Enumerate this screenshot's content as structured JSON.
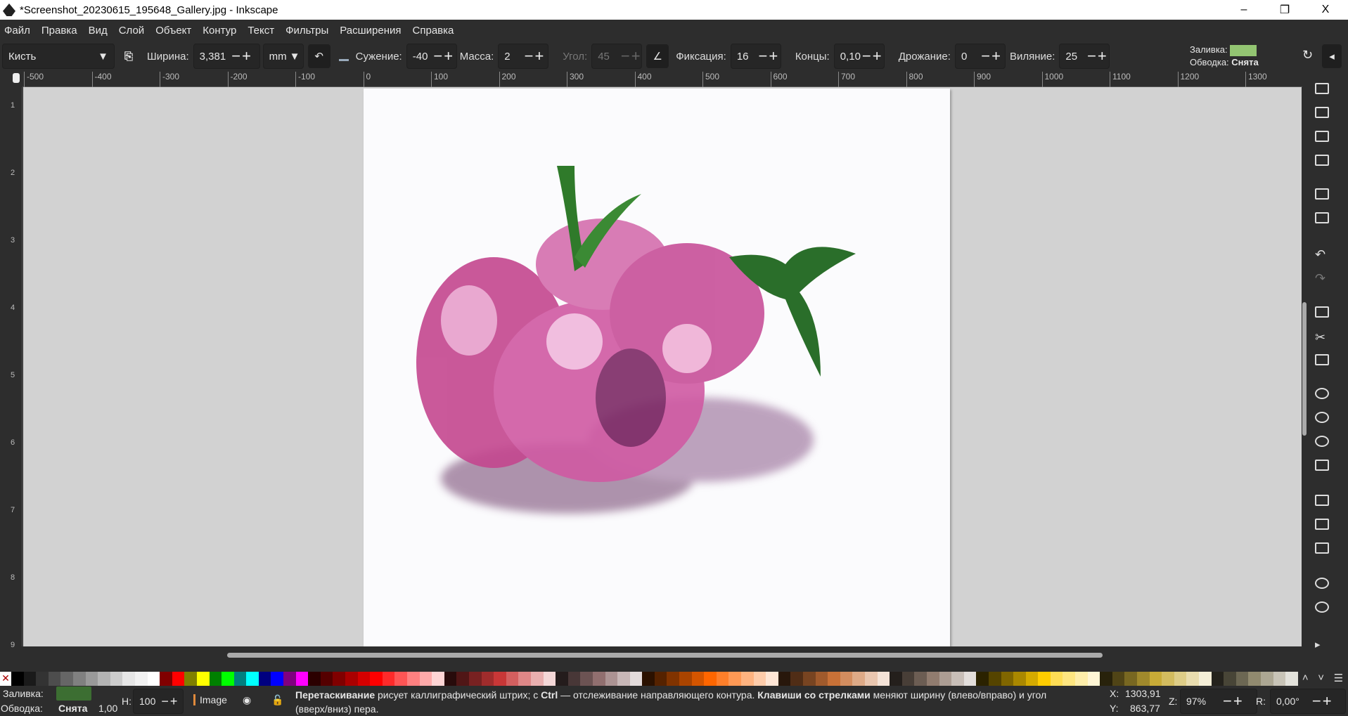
{
  "window": {
    "title": "*Screenshot_20230615_195648_Gallery.jpg - Inkscape",
    "minimize": "–",
    "maximize": "❐",
    "close": "X"
  },
  "menu": [
    "Файл",
    "Правка",
    "Вид",
    "Слой",
    "Объект",
    "Контур",
    "Текст",
    "Фильтры",
    "Расширения",
    "Справка"
  ],
  "toolbar": {
    "preset": "Кисть",
    "width_label": "Ширина:",
    "width_value": "3,381",
    "unit": "mm",
    "thinning_label": "Сужение:",
    "thinning_value": "-40",
    "mass_label": "Масса:",
    "mass_value": "2",
    "angle_label": "Угол:",
    "angle_value": "45",
    "fixation_label": "Фиксация:",
    "fixation_value": "16",
    "caps_label": "Концы:",
    "caps_value": "0,10",
    "tremor_label": "Дрожание:",
    "tremor_value": "0",
    "wiggle_label": "Виляние:",
    "wiggle_value": "25",
    "fill_label": "Заливка:",
    "fill_color": "#93c572",
    "stroke_label": "Обводка:",
    "stroke_value": "Снята"
  },
  "ruler": {
    "ticks": [
      "-500",
      "-400",
      "-300",
      "-200",
      "-100",
      "0",
      "100",
      "200",
      "300",
      "400",
      "500",
      "600",
      "700",
      "800",
      "900",
      "1000",
      "1100",
      "1200",
      "1300"
    ],
    "vticks": [
      "1",
      "2",
      "3",
      "4",
      "5",
      "6",
      "7",
      "8",
      "9"
    ]
  },
  "palette": [
    "#000000",
    "#1a1a1a",
    "#333333",
    "#4d4d4d",
    "#666666",
    "#808080",
    "#999999",
    "#b3b3b3",
    "#cccccc",
    "#e6e6e6",
    "#f2f2f2",
    "#ffffff",
    "#800000",
    "#ff0000",
    "#808000",
    "#ffff00",
    "#008000",
    "#00ff00",
    "#008080",
    "#00ffff",
    "#000080",
    "#0000ff",
    "#800080",
    "#ff00ff",
    "#2b0000",
    "#550000",
    "#800000",
    "#aa0000",
    "#d40000",
    "#ff0000",
    "#ff2a2a",
    "#ff5555",
    "#ff8080",
    "#ffaaaa",
    "#ffd5d5",
    "#280b0b",
    "#501616",
    "#782121",
    "#a02c2c",
    "#c83737",
    "#d35f5f",
    "#de8787",
    "#e9afaf",
    "#f4d7d7",
    "#241c1c",
    "#483737",
    "#6c5353",
    "#916f6f",
    "#ac9393",
    "#c8b7b7",
    "#e3dbdb",
    "#2b1100",
    "#552200",
    "#803300",
    "#aa4400",
    "#d45500",
    "#ff6600",
    "#ff7f2a",
    "#ff9955",
    "#ffb380",
    "#ffccaa",
    "#ffe6d5",
    "#28170b",
    "#502d16",
    "#784421",
    "#a05a2c",
    "#c87137",
    "#d38d5f",
    "#deaa87",
    "#e9c6af",
    "#f4e3d7",
    "#241f1c",
    "#483e37",
    "#6c5d53",
    "#917c6f",
    "#ac9d93",
    "#c8beb7",
    "#e3dedb",
    "#2b2200",
    "#554400",
    "#806600",
    "#aa8800",
    "#d4aa00",
    "#ffcc00",
    "#ffdd55",
    "#ffe680",
    "#ffeeaa",
    "#fff6d5",
    "#28220b",
    "#504416",
    "#786721",
    "#a0892c",
    "#c8ab37",
    "#d3bc5f",
    "#decd87",
    "#e9ddaf",
    "#f4eed7",
    "#24221c",
    "#484537",
    "#6c6753",
    "#918a6f",
    "#aca793",
    "#c8c4b7",
    "#e3e2db"
  ],
  "status": {
    "fill_label": "Заливка:",
    "fill_color": "#3c6e32",
    "stroke_label": "Обводка:",
    "stroke_value": "Снята",
    "stroke_width": "1,00",
    "h_label": "H:",
    "h_value": "100",
    "layer": "Image",
    "msg_b1": "Перетаскивание",
    "msg_t1": " рисует каллиграфический штрих; с ",
    "msg_b2": "Ctrl",
    "msg_t2": " — отслеживание направляющего контура. ",
    "msg_b3": "Клавиши со стрелками",
    "msg_t3": " меняют ширину (влево/вправо) и угол",
    "msg_line2": "(вверх/вниз) пера.",
    "x_label": "X:",
    "x_value": "1303,91",
    "y_label": "Y:",
    "y_value": "863,77",
    "zoom_label": "Z:",
    "zoom_value": "97%",
    "rotate_label": "R:",
    "rotate_value": "0,00°"
  }
}
